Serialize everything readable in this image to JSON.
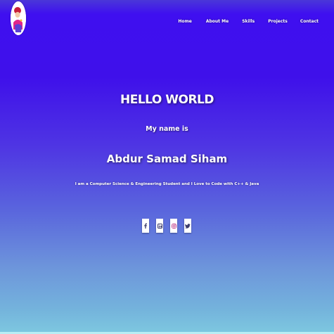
{
  "nav": {
    "items": [
      {
        "label": "Home"
      },
      {
        "label": "About Me"
      },
      {
        "label": "Skills"
      },
      {
        "label": "Projects"
      },
      {
        "label": "Contact"
      }
    ]
  },
  "hero": {
    "greeting": "HELLO WORLD",
    "intro": "My name is",
    "name": "Abdur Samad Siham",
    "tagline": "I am a Computer Science & Engineering Student and I Love to Code with C++ & Java"
  },
  "social": {
    "icons": [
      "facebook-icon",
      "linkedin-icon",
      "instagram-icon",
      "twitter-icon"
    ]
  }
}
